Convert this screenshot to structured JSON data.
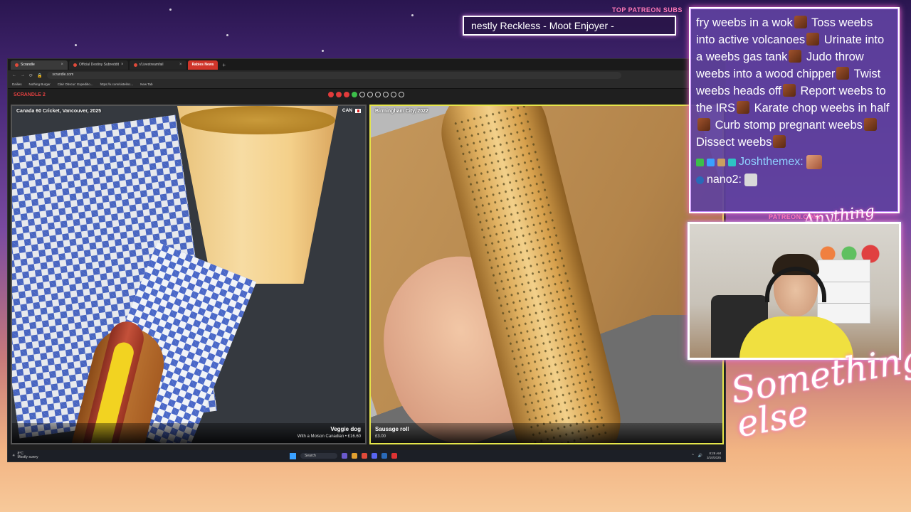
{
  "overlay": {
    "top_subs_label": "TOP PATREON SUBS",
    "subs_ticker": "nestly Reckless - Moot Enjoyer -",
    "patreon_url": "PATREON.COM/",
    "signature_small": "Anything else",
    "signature_big": "Something else"
  },
  "browser": {
    "tabs": [
      {
        "label": "Scrandle",
        "active": true
      },
      {
        "label": "Official Destiny Subreddit",
        "active": false
      },
      {
        "label": "r/Livestreamfail",
        "active": false
      }
    ],
    "badge_tab": "Rabies News",
    "new_tab": "+",
    "address": "scrandle.com",
    "bookmarks": [
      "Dailies",
      "Nothing Burger",
      "Clair Obscur: Expeditio...",
      "https://x.com/sistelinc...",
      "New Tab"
    ]
  },
  "game": {
    "title": "SCRANDLE 2",
    "header_right": "20",
    "round_dots": [
      "red",
      "red",
      "red",
      "green",
      "empty",
      "empty",
      "empty",
      "empty",
      "empty",
      "empty"
    ],
    "left_card": {
      "location": "Canada 60 Cricket, Vancouver, 2025",
      "country_code": "CAN",
      "dish_name": "Veggie dog",
      "dish_sub": "With a Molson Canadian • £16.60"
    },
    "right_card": {
      "location": "Birmingham City, 2022",
      "dish_name": "Sausage roll",
      "dish_sub": "£3.00"
    }
  },
  "taskbar": {
    "weather_temp": "8°C",
    "weather_desc": "Mostly sunny",
    "search_label": "Search",
    "time": "8:28 AM",
    "date": "3/10/2025"
  },
  "chat": {
    "message_parts": [
      "fry weebs in a wok",
      "Toss weebs into active volcanoes",
      "Urinate into a weebs gas tank",
      "Judo throw weebs into a wood chipper",
      "Twist weebs heads off",
      "Report weebs to the IRS",
      "Karate chop weebs in half",
      "Curb stomp pregnant weebs",
      "Dissect weebs"
    ],
    "user1": "Joshthemex:",
    "user2": "nano2:"
  },
  "colors": {
    "selected_border": "#e6e64a",
    "accent_pink": "#ff5ac0",
    "chat_bg": "#5f41a0"
  }
}
